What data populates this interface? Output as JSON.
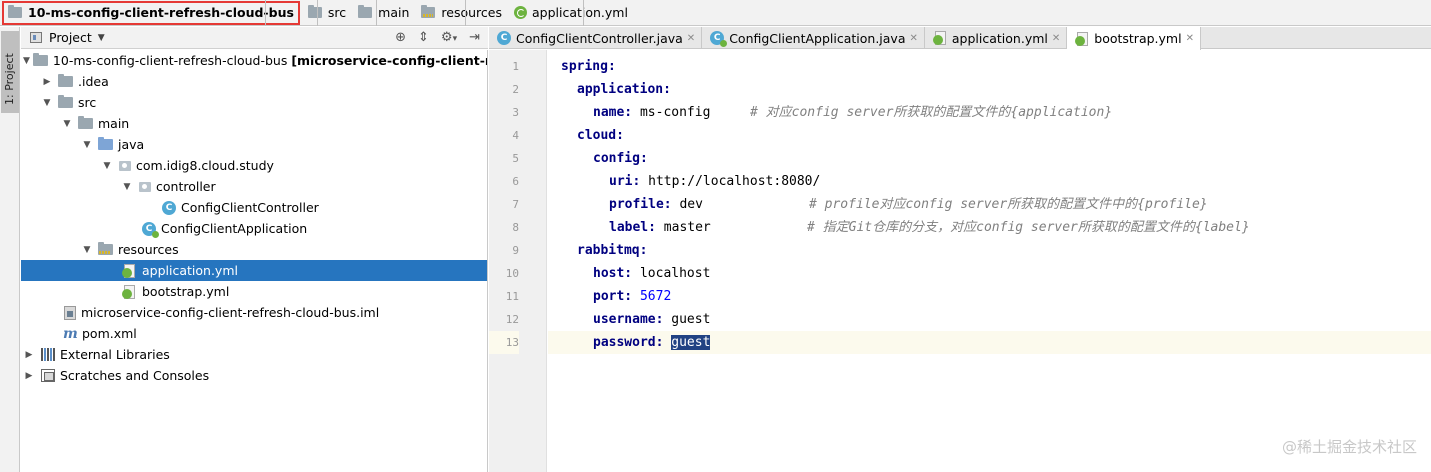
{
  "breadcrumbs": [
    {
      "label": "10-ms-config-client-refresh-cloud-bus",
      "icon": "project-folder-icon"
    },
    {
      "label": "src",
      "icon": "folder-icon"
    },
    {
      "label": "main",
      "icon": "folder-icon"
    },
    {
      "label": "resources",
      "icon": "resources-folder-icon"
    },
    {
      "label": "application.yml",
      "icon": "spring-yml-icon"
    }
  ],
  "toolstrip": {
    "project_tab": "1: Project"
  },
  "project_panel": {
    "title": "Project",
    "tree": [
      {
        "label": "10-ms-config-client-refresh-cloud-bus",
        "suffix": "[microservice-config-client-refres",
        "icon": "module-folder-icon",
        "expanded": true
      },
      {
        "label": ".idea",
        "icon": "folder-icon",
        "expanded": false
      },
      {
        "label": "src",
        "icon": "folder-icon",
        "expanded": true
      },
      {
        "label": "main",
        "icon": "folder-icon",
        "expanded": true
      },
      {
        "label": "java",
        "icon": "source-folder-icon",
        "expanded": true
      },
      {
        "label": "com.idig8.cloud.study",
        "icon": "package-icon",
        "expanded": true
      },
      {
        "label": "controller",
        "icon": "package-icon",
        "expanded": true
      },
      {
        "label": "ConfigClientController",
        "icon": "class-icon"
      },
      {
        "label": "ConfigClientApplication",
        "icon": "spring-boot-class-icon"
      },
      {
        "label": "resources",
        "icon": "resources-folder-icon",
        "expanded": true
      },
      {
        "label": "application.yml",
        "icon": "spring-yml-icon",
        "selected": true
      },
      {
        "label": "bootstrap.yml",
        "icon": "spring-yml-icon"
      },
      {
        "label": "microservice-config-client-refresh-cloud-bus.iml",
        "icon": "iml-file-icon"
      },
      {
        "label": "pom.xml",
        "icon": "maven-pom-icon"
      },
      {
        "label": "External Libraries",
        "icon": "libraries-icon",
        "expanded": false
      },
      {
        "label": "Scratches and Consoles",
        "icon": "scratches-icon",
        "expanded": false
      }
    ]
  },
  "editor_tabs": [
    {
      "label": "ConfigClientController.java",
      "icon": "class-icon",
      "active": false
    },
    {
      "label": "ConfigClientApplication.java",
      "icon": "spring-boot-class-icon",
      "active": false
    },
    {
      "label": "application.yml",
      "icon": "spring-yml-icon",
      "active": false
    },
    {
      "label": "bootstrap.yml",
      "icon": "spring-yml-icon",
      "active": true
    }
  ],
  "editor": {
    "lines": [
      {
        "num": "1",
        "key": "spring:",
        "val": "",
        "comment": ""
      },
      {
        "num": "2",
        "key": "application:",
        "val": "",
        "comment": ""
      },
      {
        "num": "3",
        "key": "name:",
        "val": " ms-config",
        "comment": "# 对应config server所获取的配置文件的{application}"
      },
      {
        "num": "4",
        "key": "cloud:",
        "val": "",
        "comment": ""
      },
      {
        "num": "5",
        "key": "config:",
        "val": "",
        "comment": ""
      },
      {
        "num": "6",
        "key": "uri:",
        "val": " http://localhost:8080/",
        "comment": ""
      },
      {
        "num": "7",
        "key": "profile:",
        "val": " dev",
        "comment": "# profile对应config server所获取的配置文件中的{profile}"
      },
      {
        "num": "8",
        "key": "label:",
        "val": " master",
        "comment": "# 指定Git仓库的分支，对应config server所获取的配置文件的{label}"
      },
      {
        "num": "9",
        "key": "rabbitmq:",
        "val": "",
        "comment": ""
      },
      {
        "num": "10",
        "key": "host:",
        "val": " localhost",
        "comment": ""
      },
      {
        "num": "11",
        "key": "port:",
        "val": " 5672",
        "comment": ""
      },
      {
        "num": "12",
        "key": "username:",
        "val": " guest",
        "comment": ""
      },
      {
        "num": "13",
        "key": "password:",
        "val": "guest",
        "comment": ""
      }
    ]
  },
  "watermark": "@稀土掘金技术社区"
}
